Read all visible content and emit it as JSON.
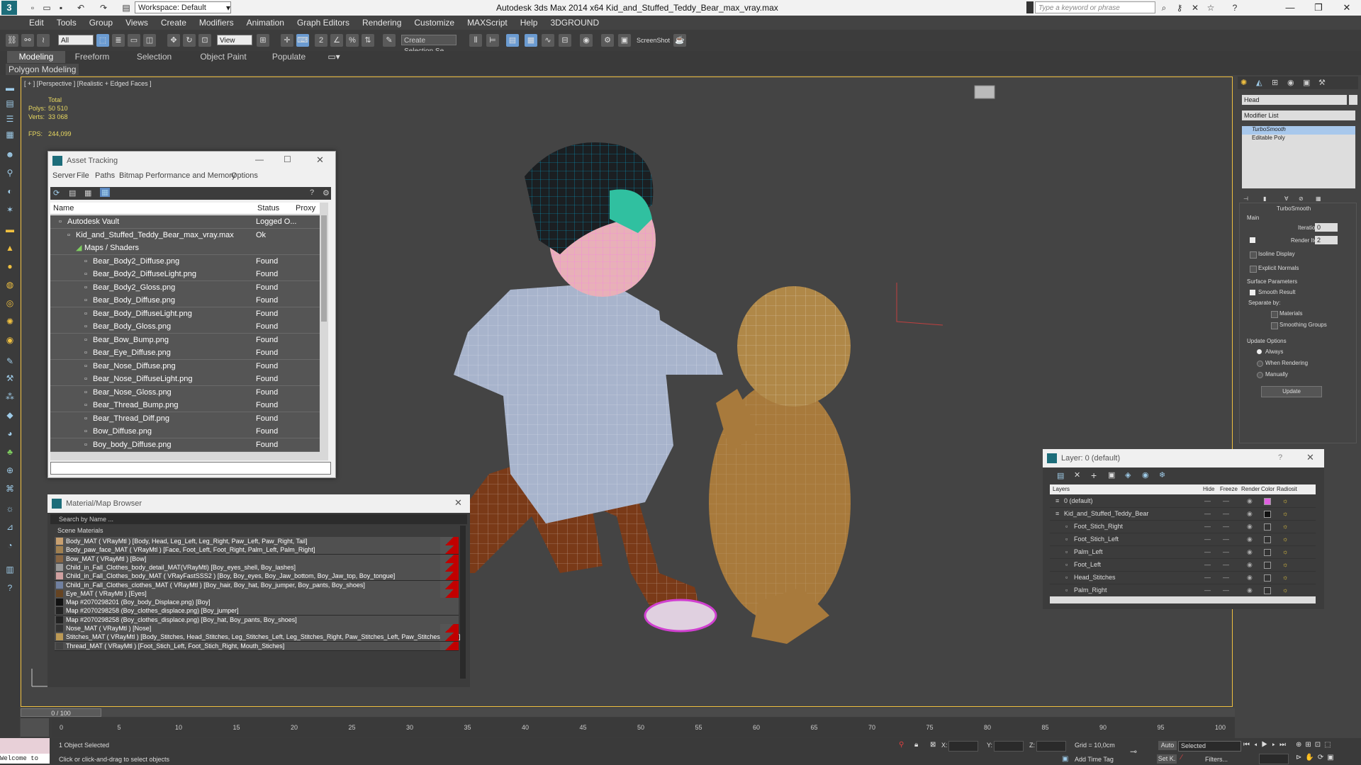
{
  "titlebar": {
    "workspace": "Workspace: Default",
    "title": "Autodesk 3ds Max  2014 x64     Kid_and_Stuffed_Teddy_Bear_max_vray.max",
    "search_placeholder": "Type a keyword or phrase"
  },
  "menubar": {
    "items": [
      "Edit",
      "Tools",
      "Group",
      "Views",
      "Create",
      "Modifiers",
      "Animation",
      "Graph Editors",
      "Rendering",
      "Customize",
      "MAXScript",
      "Help",
      "3DGROUND"
    ]
  },
  "toolbar": {
    "selection_filter": "All",
    "ref_coord": "View",
    "named_selection": "Create Selection Se",
    "screenshot_label": "ScreenShot"
  },
  "ribbon": {
    "tabs": [
      "Modeling",
      "Freeform",
      "Selection",
      "Object Paint",
      "Populate"
    ],
    "sub": "Polygon Modeling"
  },
  "viewport": {
    "label": "[ + ] [Perspective ] [Realistic + Edged Faces ]",
    "stats": {
      "total_label": "Total",
      "polys_label": "Polys:",
      "polys": "50 510",
      "verts_label": "Verts:",
      "verts": "33 068",
      "fps_label": "FPS:",
      "fps": "244,099"
    }
  },
  "asset_tracking": {
    "title": "Asset Tracking",
    "menu": [
      "Server",
      "File",
      "Paths",
      "Bitmap Performance and Memory",
      "Options"
    ],
    "columns": [
      "Name",
      "Status",
      "Proxy"
    ],
    "rows": [
      {
        "name": "Autodesk Vault",
        "status": "Logged O...",
        "indent": 1
      },
      {
        "name": "Kid_and_Stuffed_Teddy_Bear_max_vray.max",
        "status": "Ok",
        "indent": 2
      },
      {
        "name": "Maps / Shaders",
        "status": "",
        "indent": 3
      },
      {
        "name": "Bear_Body2_Diffuse.png",
        "status": "Found",
        "indent": 4
      },
      {
        "name": "Bear_Body2_DiffuseLight.png",
        "status": "Found",
        "indent": 4
      },
      {
        "name": "Bear_Body2_Gloss.png",
        "status": "Found",
        "indent": 4
      },
      {
        "name": "Bear_Body_Diffuse.png",
        "status": "Found",
        "indent": 4
      },
      {
        "name": "Bear_Body_DiffuseLight.png",
        "status": "Found",
        "indent": 4
      },
      {
        "name": "Bear_Body_Gloss.png",
        "status": "Found",
        "indent": 4
      },
      {
        "name": "Bear_Bow_Bump.png",
        "status": "Found",
        "indent": 4
      },
      {
        "name": "Bear_Eye_Diffuse.png",
        "status": "Found",
        "indent": 4
      },
      {
        "name": "Bear_Nose_Diffuse.png",
        "status": "Found",
        "indent": 4
      },
      {
        "name": "Bear_Nose_DiffuseLight.png",
        "status": "Found",
        "indent": 4
      },
      {
        "name": "Bear_Nose_Gloss.png",
        "status": "Found",
        "indent": 4
      },
      {
        "name": "Bear_Thread_Bump.png",
        "status": "Found",
        "indent": 4
      },
      {
        "name": "Bear_Thread_Diff.png",
        "status": "Found",
        "indent": 4
      },
      {
        "name": "Bow_Diffuse.png",
        "status": "Found",
        "indent": 4
      },
      {
        "name": "Boy_body_Diffuse.png",
        "status": "Found",
        "indent": 4
      }
    ]
  },
  "material_browser": {
    "title": "Material/Map Browser",
    "search_placeholder": "Search by Name ...",
    "section": "Scene Materials",
    "rows": [
      {
        "text": "Body_MAT ( VRayMtl ) [Body, Head, Leg_Left, Leg_Right, Paw_Left, Paw_Right, Tail]",
        "red": true,
        "sw": "#c8a070"
      },
      {
        "text": "Body_paw_face_MAT ( VRayMtl ) [Face, Foot_Left, Foot_Right, Palm_Left, Palm_Right]",
        "red": true,
        "sw": "#a08050"
      },
      {
        "text": "Bow_MAT ( VRayMtl ) [Bow]",
        "red": true,
        "sw": "#886644"
      },
      {
        "text": "Child_in_Fall_Clothes_body_detail_MAT(VRayMtl) [Boy_eyes_shell, Boy_lashes]",
        "red": true,
        "sw": "#999999"
      },
      {
        "text": "Child_in_Fall_Clothes_body_MAT ( VRayFastSSS2 ) [Boy, Boy_eyes, Boy_Jaw_bottom, Boy_Jaw_top, Boy_tongue]",
        "red": true,
        "sw": "#d0a0a0"
      },
      {
        "text": "Child_in_Fall_Clothes_clothes_MAT ( VRayMtl ) [Boy_hair, Boy_hat, Boy_jumper, Boy_pants, Boy_shoes]",
        "red": true,
        "sw": "#7080a0"
      },
      {
        "text": "Eye_MAT ( VRayMtl ) [Eyes]",
        "red": true,
        "sw": "#664422"
      },
      {
        "text": "Map #2070298201 (Boy_body_Displace.png) [Boy]",
        "red": false,
        "sw": "#111111"
      },
      {
        "text": "Map #2070298258 (Boy_clothes_displace.png) [Boy_jumper]",
        "red": false,
        "sw": "#222222"
      },
      {
        "text": "Map #2070298258 (Boy_clothes_displace.png) [Boy_hat, Boy_pants, Boy_shoes]",
        "red": false,
        "sw": "#222222"
      },
      {
        "text": "Nose_MAT ( VRayMtl ) [Nose]",
        "red": true,
        "sw": "#333333"
      },
      {
        "text": "Stitches_MAT ( VRayMtl ) [Body_Stitches, Head_Stitches, Leg_Stitches_Left, Leg_Stitches_Right, Paw_Stitches_Left, Paw_Stitches_Right]",
        "red": true,
        "sw": "#bb9955"
      },
      {
        "text": "Thread_MAT ( VRayMtl ) [Foot_Stich_Left, Foot_Stich_Right, Mouth_Stiches]",
        "red": true,
        "sw": "#444444"
      }
    ]
  },
  "layers": {
    "title": "Layer: 0 (default)",
    "columns": [
      "Layers",
      "Hide",
      "Freeze",
      "Render",
      "Color",
      "Radiosit"
    ],
    "rows": [
      {
        "name": "0 (default)",
        "indent": 0,
        "color": "#e060e0"
      },
      {
        "name": "Kid_and_Stuffed_Teddy_Bear",
        "indent": 0,
        "color": "#111111"
      },
      {
        "name": "Foot_Stich_Right",
        "indent": 1,
        "color": "#333333"
      },
      {
        "name": "Foot_Stich_Left",
        "indent": 1,
        "color": "#333333"
      },
      {
        "name": "Palm_Left",
        "indent": 1,
        "color": "#333333"
      },
      {
        "name": "Foot_Left",
        "indent": 1,
        "color": "#333333"
      },
      {
        "name": "Head_Stitches",
        "indent": 1,
        "color": "#333333"
      },
      {
        "name": "Palm_Right",
        "indent": 1,
        "color": "#333333"
      }
    ]
  },
  "cmdpanel": {
    "object_name": "Head",
    "modifier_list": "Modifier List",
    "stack": [
      "TurboSmooth",
      "Editable Poly"
    ],
    "rollout_title": "TurboSmooth",
    "main_label": "Main",
    "iterations_label": "Iterations:",
    "iterations": "0",
    "render_iters_label": "Render Iters:",
    "render_iters": "2",
    "isoline": "Isoline Display",
    "explicit": "Explicit Normals",
    "surface_params": "Surface Parameters",
    "smooth_result": "Smooth Result",
    "separate_by": "Separate by:",
    "materials": "Materials",
    "smoothing_groups": "Smoothing Groups",
    "update_options": "Update Options",
    "always": "Always",
    "when_rendering": "When Rendering",
    "manually": "Manually",
    "update_btn": "Update"
  },
  "timeline": {
    "frame": "0 / 100",
    "ticks": [
      "0",
      "5",
      "10",
      "15",
      "20",
      "25",
      "30",
      "35",
      "40",
      "45",
      "50",
      "55",
      "60",
      "65",
      "70",
      "75",
      "80",
      "85",
      "90",
      "95",
      "100"
    ]
  },
  "statusbar": {
    "welcome": "Welcome to",
    "selected": "1 Object Selected",
    "prompt": "Click or click-and-drag to select objects",
    "x_label": "X:",
    "y_label": "Y:",
    "z_label": "Z:",
    "grid": "Grid = 10,0cm",
    "auto": "Auto",
    "selected_dropdown": "Selected",
    "set_k": "Set K.",
    "filters": "Filters...",
    "add_time_tag": "Add Time Tag"
  }
}
